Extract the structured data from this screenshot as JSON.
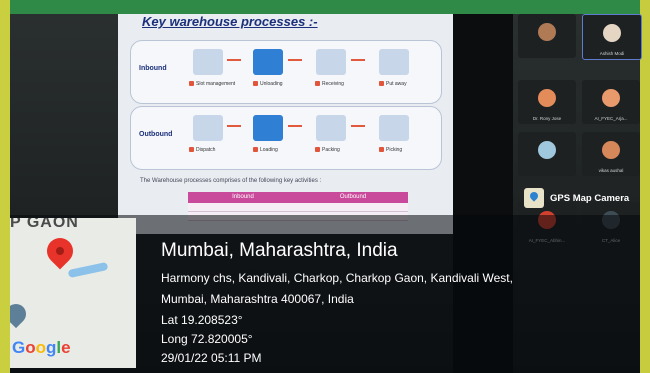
{
  "slide": {
    "title": "Key warehouse processes :-",
    "panels": [
      {
        "label": "Inbound",
        "steps": [
          "Slot management",
          "Unloading",
          "Receiving",
          "Put away"
        ]
      },
      {
        "label": "Outbound",
        "steps": [
          "Dispatch",
          "Loading",
          "Packing",
          "Picking"
        ]
      }
    ],
    "caption": "The Warehouse processes comprises of the following key activities :",
    "table_headers": [
      "Inbound",
      "Outbound"
    ]
  },
  "participants": [
    {
      "name": ""
    },
    {
      "name": "Ashish Modi"
    },
    {
      "name": "Dr. Rony Jose"
    },
    {
      "name": "AI_FYEC_Arja..."
    },
    {
      "name": ""
    },
    {
      "name": "vikas aushal"
    },
    {
      "name": "AI_FYEC_Abhin..."
    },
    {
      "name": "CT_Alice"
    }
  ],
  "gps": {
    "app_name": "GPS Map Camera",
    "title": "Mumbai, Maharashtra, India",
    "address_line1": "Harmony chs, Kandivali, Charkop, Charkop Gaon, Kandivali West,",
    "address_line2": "Mumbai, Maharashtra 400067, India",
    "lat": "Lat 19.208523°",
    "long": "Long 72.820005°",
    "datetime": "29/01/22 05:11 PM",
    "map_area_text": "P GAON",
    "map_logo": [
      "G",
      "o",
      "o",
      "g",
      "l",
      "e"
    ]
  },
  "colors": {
    "frame_top": "#2f8a47",
    "frame_side": "#c9cf3e",
    "slide_accent": "#1b2f7a",
    "table_header": "#c94a9a",
    "pin_red": "#e8332a"
  }
}
